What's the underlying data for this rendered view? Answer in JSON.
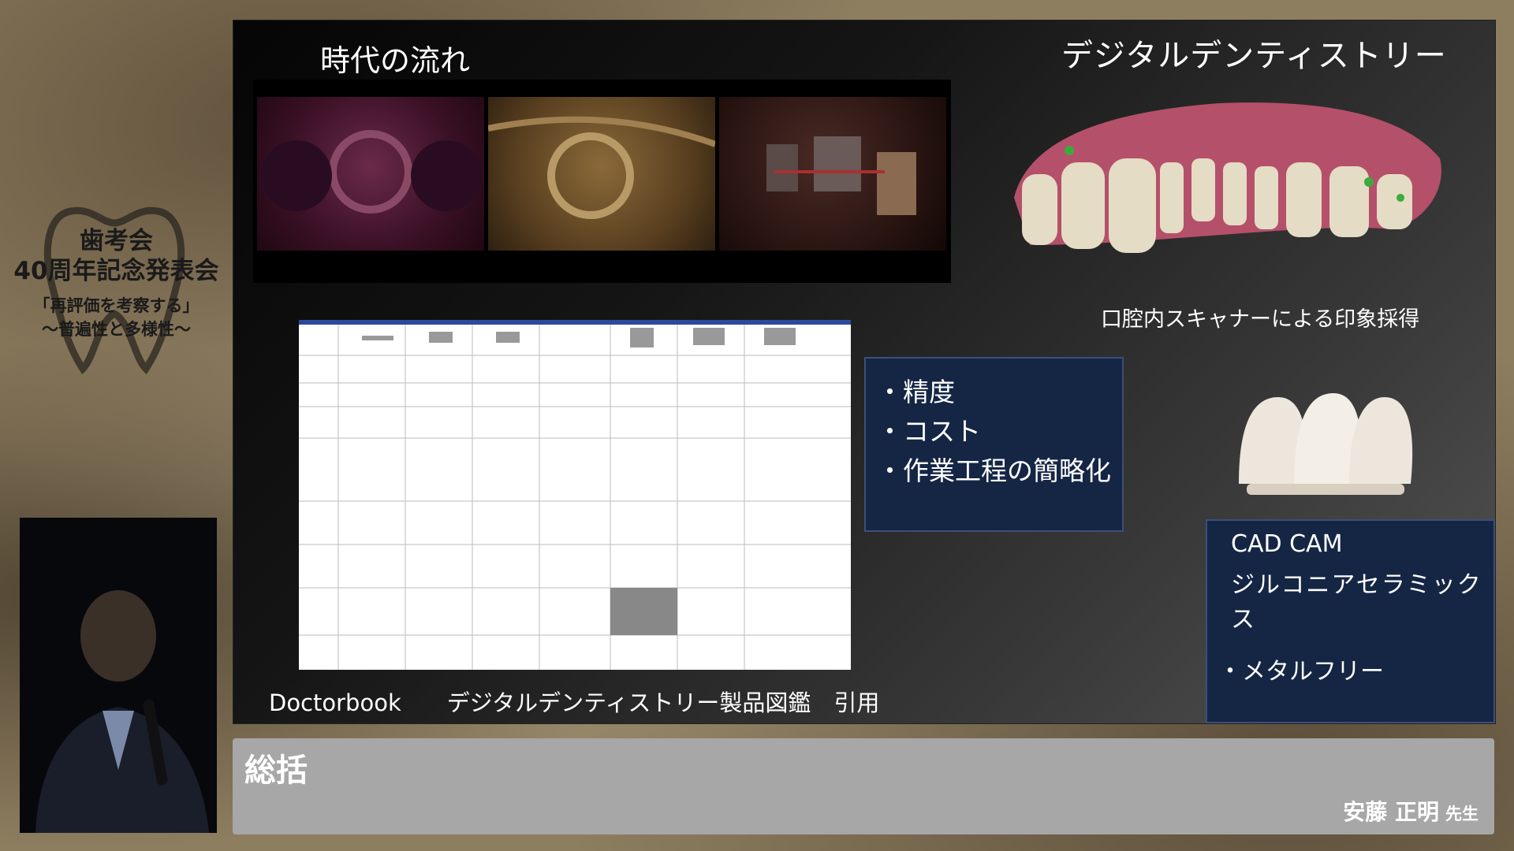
{
  "branding": {
    "org_title": "歯考会",
    "event_title": "40周年記念発表会",
    "tagline_1": "「再評価を考察する」",
    "tagline_2": "〜普遍性と多様性〜"
  },
  "slide": {
    "title": "時代の流れ",
    "topic": "デジタルデンティストリー",
    "scan_caption": "口腔内スキャナーによる印象採得",
    "citation_source": "Doctorbook",
    "citation_text": "デジタルデンティストリー製品図鑑　引用",
    "points": [
      "・精度",
      "・コスト",
      "・作業工程の簡略化"
    ],
    "cadcam": {
      "line_1": "CAD CAM",
      "line_2": "ジルコニアセラミックス",
      "point": "・メタルフリー"
    }
  },
  "bottom_bar": {
    "section": "総括",
    "presenter_name": "安藤 正明",
    "presenter_honorific": "先生"
  },
  "colors": {
    "box_bg": "#152645",
    "bar_bg": "#a7a7a7"
  }
}
